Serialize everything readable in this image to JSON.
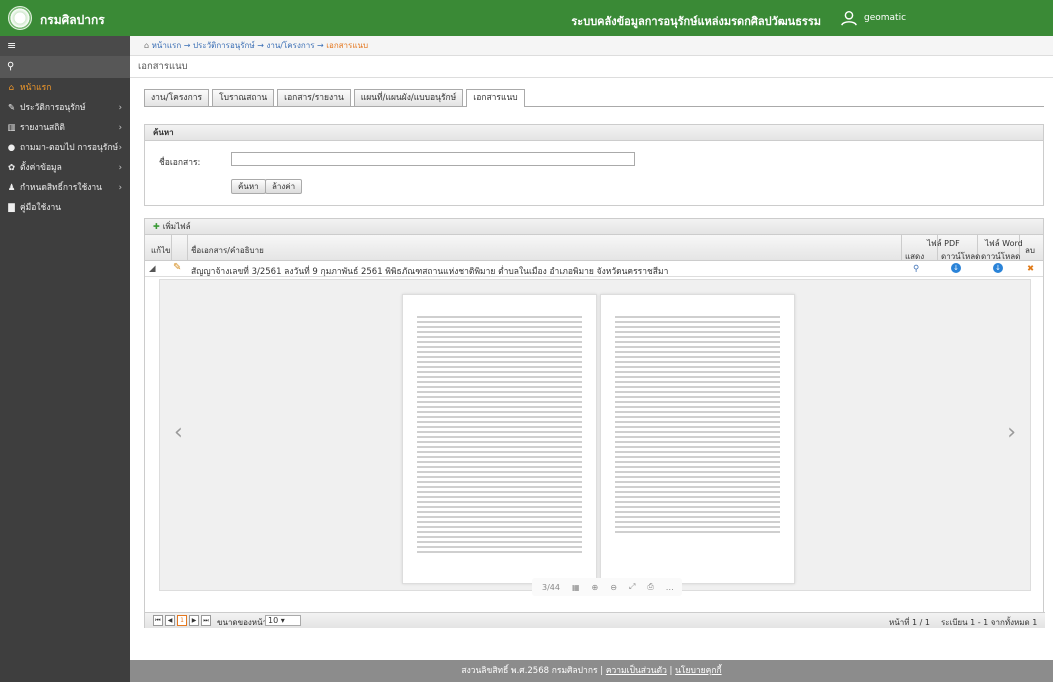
{
  "header": {
    "brand": "กรมศิลปากร",
    "system_title": "ระบบคลังข้อมูลการอนุรักษ์แหล่งมรดกศิลปวัฒนธรรม",
    "username": "geomatic",
    "color": "#3a8a36"
  },
  "sidebar": {
    "items": [
      {
        "icon": "house-icon",
        "label": "หน้าแรก"
      },
      {
        "icon": "edit-icon",
        "label": "ประวัติการอนุรักษ์"
      },
      {
        "icon": "bar-chart-icon",
        "label": "รายงานสถิติ"
      },
      {
        "icon": "comment-icon",
        "label": "ถามมา-ตอบไป การอนุรักษ์"
      },
      {
        "icon": "gear-icon",
        "label": "ตั้งค่าข้อมูล"
      },
      {
        "icon": "person-icon",
        "label": "กำหนดสิทธิ์การใช้งาน"
      },
      {
        "icon": "book-icon",
        "label": "คู่มือใช้งาน"
      }
    ]
  },
  "breadcrumb": {
    "home": "หน้าแรก",
    "sep": "→",
    "level1": "ประวัติการอนุรักษ์",
    "level2": "งาน/โครงการ",
    "current": "เอกสารแนบ"
  },
  "page_title": "เอกสารแนบ",
  "tabs": [
    "งาน/โครงการ",
    "โบราณสถาน",
    "เอกสาร/รายงาน",
    "แผนที่/แผนผัง/แบบอนุรักษ์",
    "เอกสารแนบ"
  ],
  "search": {
    "header": "ค้นหา",
    "label": "ชื่อเอกสาร:",
    "value": "",
    "search_btn": "ค้นหา",
    "clear_btn": "ล้างค่า"
  },
  "grid": {
    "add_label": "เพิ่มไฟล์",
    "headers": {
      "edit": "แก้ไข",
      "name": "ชื่อเอกสาร/คำอธิบาย",
      "pdf_group": "ไฟล์ PDF",
      "word_group": "ไฟล์ Word",
      "show": "แสดง",
      "download_pdf": "ดาวน์โหลด",
      "download_word": "ดาวน์โหลด",
      "delete": "ลบ"
    },
    "row": {
      "name": "สัญญาจ้างเลขที่ 3/2561 ลงวันที่ 9 กุมภาพันธ์ 2561 พิพิธภัณฑสถานแห่งชาติพิมาย ต่ำบลในเมือง อำเภอพิมาย จังหวัดนครราชสีมา"
    },
    "viewer": {
      "page_indicator": "3/44"
    },
    "pager": {
      "page": "1",
      "page_size_label": "ขนาดของหน้า:",
      "page_size": "10",
      "page_info": "หน้าที่ 1 / 1",
      "record_info": "ระเบียน 1 - 1 จากทั้งหมด 1"
    }
  },
  "footer": {
    "copyright": "สงวนลิขสิทธิ์ พ.ศ.2568 กรมศิลปากร",
    "privacy": "ความเป็นส่วนตัว",
    "policy": "นโยบายคุกกี้"
  }
}
